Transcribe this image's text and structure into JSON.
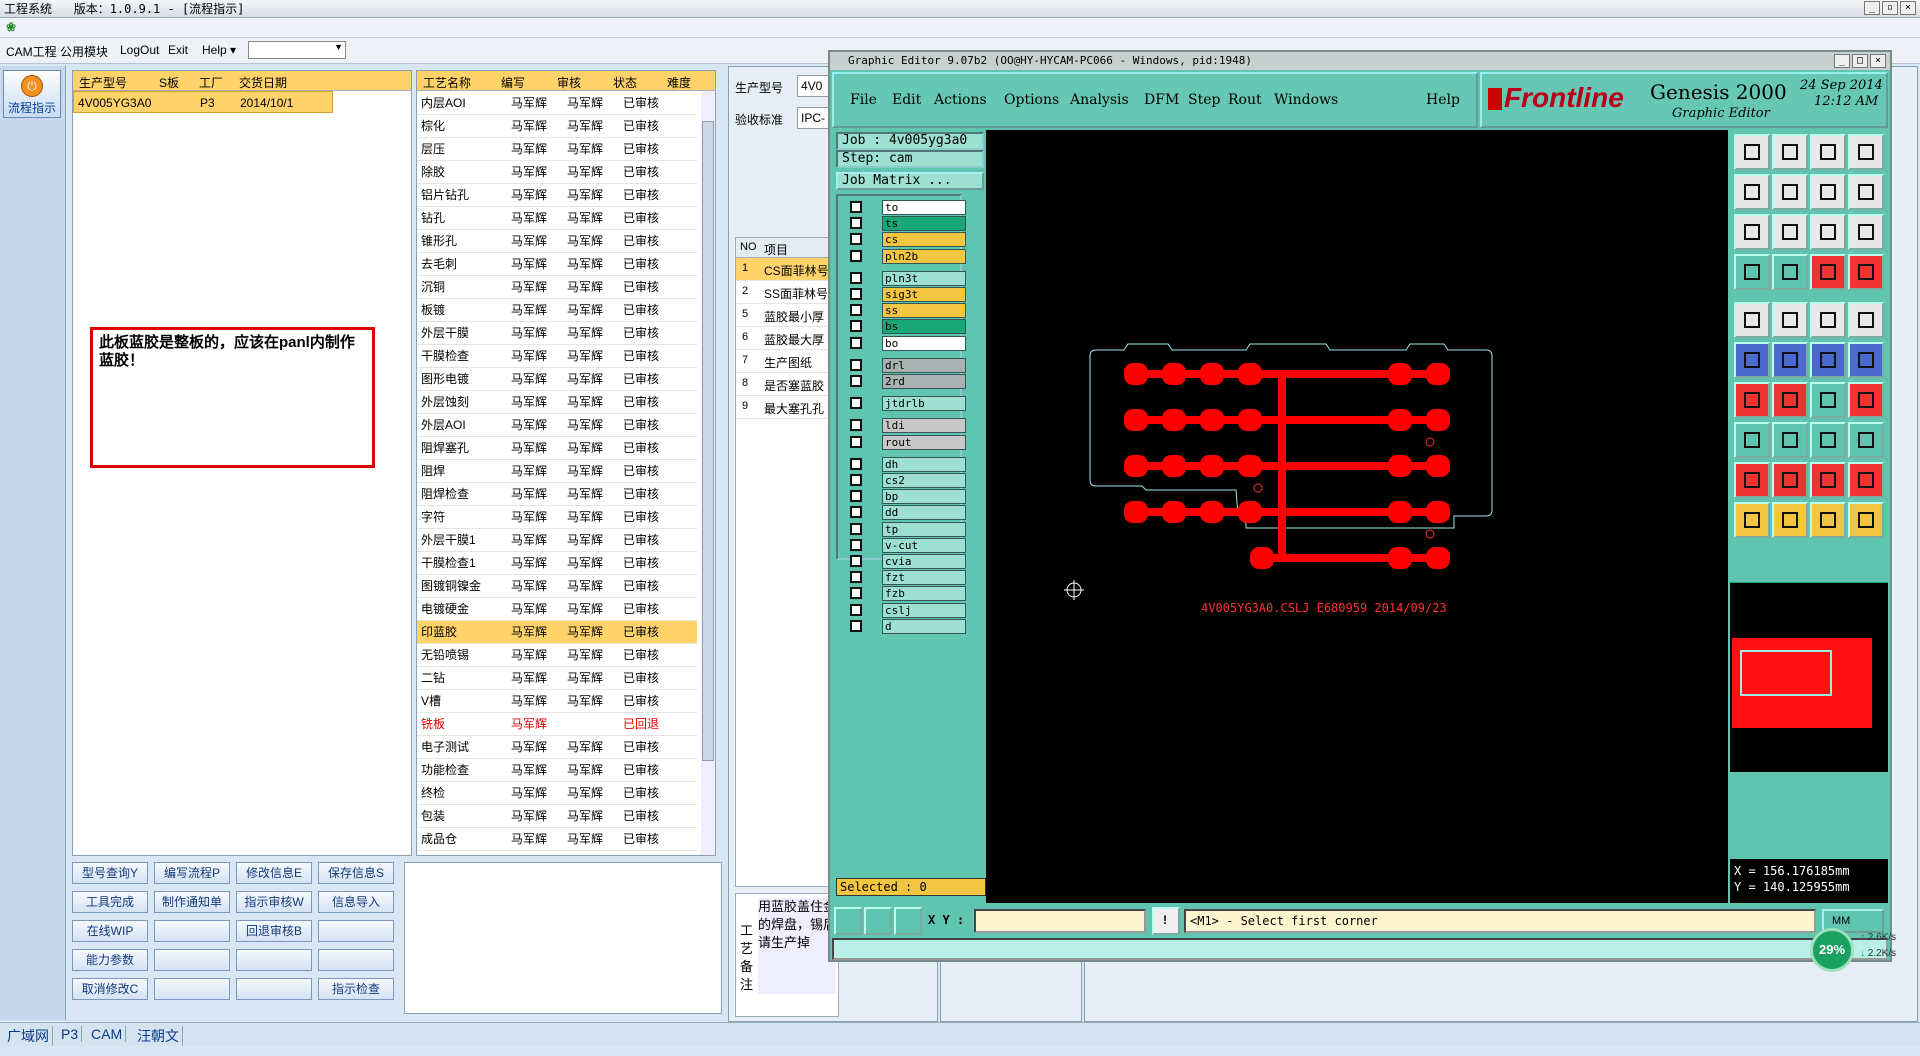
{
  "app": {
    "title": "工程系统",
    "version": "版本：1.0.9.1 - [流程指示]"
  },
  "menubar": {
    "items": [
      "CAM工程",
      "公用模块",
      "LogOut",
      "Exit",
      "Help ▾"
    ]
  },
  "sidebar": {
    "button": "流程指示"
  },
  "production": {
    "headers": [
      "生产型号",
      "S板",
      "工厂",
      "交货日期"
    ],
    "row": [
      "4V005YG3A0",
      "",
      "P3",
      "2014/10/1"
    ]
  },
  "process": {
    "headers": [
      "工艺名称",
      "编写",
      "审核",
      "状态",
      "难度"
    ],
    "rows": [
      [
        "内层AOI",
        "马军辉",
        "马军辉",
        "已审核"
      ],
      [
        "棕化",
        "马军辉",
        "马军辉",
        "已审核"
      ],
      [
        "层压",
        "马军辉",
        "马军辉",
        "已审核"
      ],
      [
        "除胶",
        "马军辉",
        "马军辉",
        "已审核"
      ],
      [
        "铝片钻孔",
        "马军辉",
        "马军辉",
        "已审核"
      ],
      [
        "钻孔",
        "马军辉",
        "马军辉",
        "已审核"
      ],
      [
        "锥形孔",
        "马军辉",
        "马军辉",
        "已审核"
      ],
      [
        "去毛刺",
        "马军辉",
        "马军辉",
        "已审核"
      ],
      [
        "沉铜",
        "马军辉",
        "马军辉",
        "已审核"
      ],
      [
        "板镀",
        "马军辉",
        "马军辉",
        "已审核"
      ],
      [
        "外层干膜",
        "马军辉",
        "马军辉",
        "已审核"
      ],
      [
        "干膜检查",
        "马军辉",
        "马军辉",
        "已审核"
      ],
      [
        "图形电镀",
        "马军辉",
        "马军辉",
        "已审核"
      ],
      [
        "外层蚀刻",
        "马军辉",
        "马军辉",
        "已审核"
      ],
      [
        "外层AOI",
        "马军辉",
        "马军辉",
        "已审核"
      ],
      [
        "阻焊塞孔",
        "马军辉",
        "马军辉",
        "已审核"
      ],
      [
        "阻焊",
        "马军辉",
        "马军辉",
        "已审核"
      ],
      [
        "阻焊检查",
        "马军辉",
        "马军辉",
        "已审核"
      ],
      [
        "字符",
        "马军辉",
        "马军辉",
        "已审核"
      ],
      [
        "外层干膜1",
        "马军辉",
        "马军辉",
        "已审核"
      ],
      [
        "干膜检查1",
        "马军辉",
        "马军辉",
        "已审核"
      ],
      [
        "图镀铜镍金",
        "马军辉",
        "马军辉",
        "已审核"
      ],
      [
        "电镀硬金",
        "马军辉",
        "马军辉",
        "已审核"
      ],
      [
        "印蓝胶",
        "马军辉",
        "马军辉",
        "已审核"
      ],
      [
        "无铅喷锡",
        "马军辉",
        "马军辉",
        "已审核"
      ],
      [
        "二钻",
        "马军辉",
        "马军辉",
        "已审核"
      ],
      [
        "V槽",
        "马军辉",
        "马军辉",
        "已审核"
      ],
      [
        "铣板",
        "马军辉",
        "",
        "已回退"
      ],
      [
        "电子测试",
        "马军辉",
        "马军辉",
        "已审核"
      ],
      [
        "功能检查",
        "马军辉",
        "马军辉",
        "已审核"
      ],
      [
        "终检",
        "马军辉",
        "马军辉",
        "已审核"
      ],
      [
        "包装",
        "马军辉",
        "马军辉",
        "已审核"
      ],
      [
        "成品仓",
        "马军辉",
        "马军辉",
        "已审核"
      ]
    ]
  },
  "note": {
    "text": "此板蓝胶是整板的，应该在panl内制作蓝胶！"
  },
  "buttons": [
    [
      "型号查询Y",
      "编写流程P",
      "修改信息E",
      "保存信息S"
    ],
    [
      "工具完成",
      "制作通知单",
      "指示审核W",
      "信息导入"
    ],
    [
      "在线WIP",
      "",
      "回退审核B",
      ""
    ],
    [
      "能力参数",
      "",
      "",
      ""
    ],
    [
      "取消修改C",
      "",
      "",
      "指示检查"
    ]
  ],
  "right": {
    "prod_label": "生产型号",
    "prod_value": "4V0",
    "std_label": "验收标准",
    "std_value": "IPC-",
    "items_header": [
      "NO",
      "项目"
    ],
    "items": [
      [
        "1",
        "CS面菲林号"
      ],
      [
        "2",
        "SS面菲林号"
      ],
      [
        "5",
        "蓝胶最小厚"
      ],
      [
        "6",
        "蓝胶最大厚"
      ],
      [
        "7",
        "生产图纸"
      ],
      [
        "8",
        "是否塞蓝胶"
      ],
      [
        "9",
        "最大塞孔孔"
      ]
    ],
    "remark_label": "工艺备注",
    "remark_text": "用蓝胶盖住金的焊盘，锡后请生产掉"
  },
  "genesis": {
    "title": "Graphic Editor 9.07b2 (OO@HY-HYCAM-PC066 - Windows, pid:1948)",
    "menu": [
      "File",
      "Edit",
      "Actions",
      "Options",
      "Analysis",
      "DFM",
      "Step",
      "Rout",
      "Windows",
      "Help"
    ],
    "brand": "Frontline",
    "product": "Genesis 2000",
    "subtitle": "Graphic Editor",
    "date": "24 Sep 2014",
    "time": "12:12 AM",
    "job": "Job : 4v005yg3a0",
    "step": "Step: cam",
    "matrix": "Job Matrix ...",
    "layers": [
      {
        "n": "to",
        "c": "#ffffff"
      },
      {
        "n": "ts",
        "c": "#18a878"
      },
      {
        "n": "cs",
        "c": "#f2c640"
      },
      {
        "n": "pln2b",
        "c": "#f2c640"
      },
      {
        "n": "pln3t",
        "c": "#9de0d2"
      },
      {
        "n": "sig3t",
        "c": "#f2c640"
      },
      {
        "n": "ss",
        "c": "#f2c640"
      },
      {
        "n": "bs",
        "c": "#18a878"
      },
      {
        "n": "bo",
        "c": "#ffffff"
      },
      {
        "n": "drl",
        "c": "#a8b0b0"
      },
      {
        "n": "2rd",
        "c": "#a8b0b0"
      },
      {
        "n": "jtdrlb",
        "c": "#9de0d2"
      },
      {
        "n": "ldi",
        "c": "#c8c8c8"
      },
      {
        "n": "rout",
        "c": "#c8c8c8"
      },
      {
        "n": "dh",
        "c": "#9de0d2"
      },
      {
        "n": "cs2",
        "c": "#9de0d2"
      },
      {
        "n": "bp",
        "c": "#9de0d2"
      },
      {
        "n": "dd",
        "c": "#9de0d2"
      },
      {
        "n": "tp",
        "c": "#9de0d2"
      },
      {
        "n": "v-cut",
        "c": "#9de0d2"
      },
      {
        "n": "cvia",
        "c": "#9de0d2"
      },
      {
        "n": "fzt",
        "c": "#9de0d2"
      },
      {
        "n": "fzb",
        "c": "#9de0d2"
      },
      {
        "n": "cslj",
        "c": "#9de0d2"
      },
      {
        "n": "d",
        "c": "#9de0d2"
      }
    ],
    "selected": "Selected : 0",
    "xy_label": "X Y :",
    "prompt": "<M1> - Select first corner",
    "units": "MM",
    "coord_x": "X = 156.176185mm",
    "coord_y": "Y = 140.125955mm",
    "board_label": "4V005YG3A0.CSLJ E680959 2014/09/23"
  },
  "net": {
    "percent": "29%",
    "up": "2.6K/s",
    "down": "2.2K/s"
  },
  "statusbar": {
    "items": [
      "广域网",
      "P3",
      "CAM",
      "汪朝文"
    ]
  },
  "colors": {
    "trace": "#ff0000",
    "outline": "#9ee8e8",
    "accent": "#ffd36a"
  }
}
